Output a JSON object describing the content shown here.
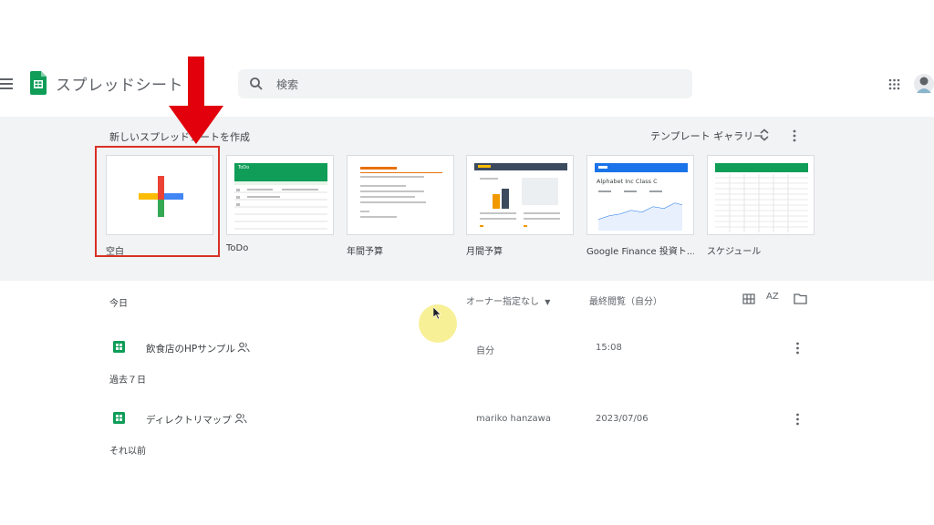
{
  "header": {
    "app_title": "スプレッドシート",
    "search_placeholder": "検索"
  },
  "templates": {
    "section_title": "新しいスプレッドシートを作成",
    "gallery_label": "テンプレート ギャラリー",
    "items": [
      {
        "label": "空白"
      },
      {
        "label": "ToDo"
      },
      {
        "label": "年間予算"
      },
      {
        "label": "月間予算"
      },
      {
        "label": "Google Finance 投資ト..."
      },
      {
        "label": "スケジュール"
      }
    ],
    "thumb_texts": {
      "todo_title": "ToDo",
      "finance_title": "Alphabet Inc Class C"
    }
  },
  "list": {
    "owner_filter": "オーナー指定なし",
    "last_opened": "最終閲覧（自分）",
    "sort_label": "AZ",
    "sections": [
      {
        "label": "今日"
      },
      {
        "label": "過去７日"
      },
      {
        "label": "それ以前"
      }
    ],
    "files": [
      {
        "name": "飲食店のHPサンプル",
        "owner": "自分",
        "date": "15:08"
      },
      {
        "name": "ディレクトリマップ",
        "owner": "mariko hanzawa",
        "date": "2023/07/06"
      }
    ]
  },
  "colors": {
    "sheets_green": "#0f9d58",
    "highlight_red": "#d93025",
    "band_gray": "#f1f3f4"
  }
}
